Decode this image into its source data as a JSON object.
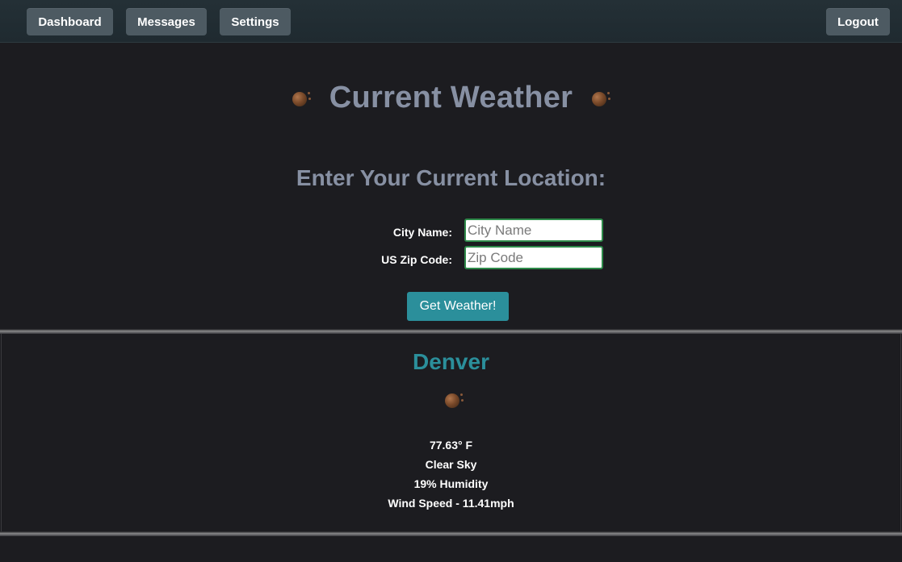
{
  "nav": {
    "dashboard_label": "Dashboard",
    "messages_label": "Messages",
    "settings_label": "Settings",
    "logout_label": "Logout"
  },
  "header": {
    "title": "Current Weather",
    "icon": "planet-icon"
  },
  "form": {
    "heading": "Enter Your Current Location:",
    "city_label": "City Name:",
    "city_placeholder": "City Name",
    "city_value": "",
    "zip_label": "US Zip Code:",
    "zip_placeholder": "Zip Code",
    "zip_value": "",
    "submit_label": "Get Weather!"
  },
  "result": {
    "city": "Denver",
    "icon": "planet-icon",
    "temperature": "77.63° F",
    "condition": "Clear Sky",
    "humidity": "19% Humidity",
    "wind": "Wind Speed - 11.41mph"
  },
  "colors": {
    "background": "#1c1c20",
    "nav_button": "#4d5a62",
    "accent": "#2b8f9b",
    "title": "#8790a3",
    "input_border": "#2e8a4a"
  }
}
